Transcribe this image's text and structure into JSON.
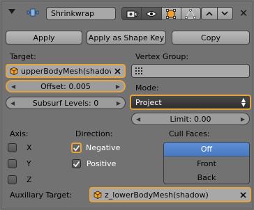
{
  "header": {
    "name": "Shrinkwrap",
    "collapse_icon": "triangle-down-icon",
    "modifier_icon": "shrinkwrap-modifier-icon",
    "toggles": [
      {
        "icon": "render-camera-icon",
        "on": true
      },
      {
        "icon": "eye-icon",
        "on": true
      },
      {
        "icon": "editmode-icon",
        "on": false
      },
      {
        "icon": "cage-vertex-icon",
        "on": false
      }
    ],
    "move_up_icon": "chevron-up-icon",
    "move_down_icon": "chevron-down-icon",
    "close_icon": "close-icon"
  },
  "actions": {
    "apply": "Apply",
    "apply_shape": "Apply as Shape Key",
    "copy": "Copy"
  },
  "target": {
    "label": "Target:",
    "value": "upperBodyMesh(shadow)"
  },
  "vertex_group": {
    "label": "Vertex Group:",
    "value": ""
  },
  "offset": {
    "label": "Offset:",
    "value": "0.005"
  },
  "subsurf": {
    "label": "Subsurf Levels:",
    "value": "0"
  },
  "mode": {
    "label": "Mode:",
    "value": "Project"
  },
  "limit": {
    "label": "Limit:",
    "value": "0.00"
  },
  "axis": {
    "label": "Axis:",
    "items": [
      {
        "label": "X",
        "checked": false
      },
      {
        "label": "Y",
        "checked": false
      },
      {
        "label": "Z",
        "checked": false
      }
    ]
  },
  "direction": {
    "label": "Direction:",
    "items": [
      {
        "label": "Negative",
        "checked": true
      },
      {
        "label": "Positive",
        "checked": true
      }
    ]
  },
  "cull_faces": {
    "label": "Cull Faces:",
    "options": [
      "Off",
      "Front",
      "Back"
    ],
    "selected": "Off"
  },
  "aux_target": {
    "label": "Auxiliary Target:",
    "value": "z_lowerBodyMesh(shadow)"
  },
  "colors": {
    "panel_bg": "#727272",
    "highlight": "#e8a43c",
    "selection": "#5b8fd6",
    "dropdown_bg": "#2e2e2e"
  }
}
